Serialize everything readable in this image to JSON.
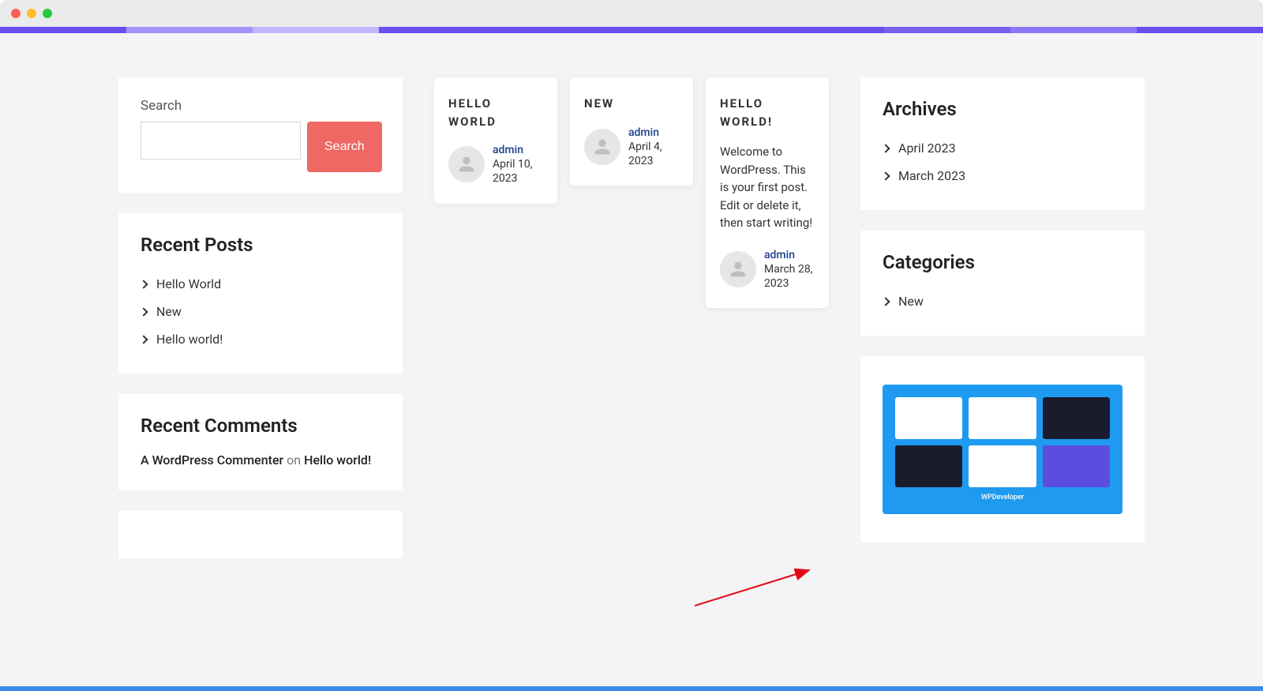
{
  "sidebar_left": {
    "search": {
      "label": "Search",
      "button": "Search",
      "value": ""
    },
    "recent_posts": {
      "heading": "Recent Posts",
      "items": [
        "Hello World",
        "New",
        "Hello world!"
      ]
    },
    "recent_comments": {
      "heading": "Recent Comments",
      "commenter": "A WordPress Commenter",
      "on": "on",
      "post": "Hello world!"
    }
  },
  "posts": [
    {
      "title": "HELLO WORLD",
      "author": "admin",
      "date": "April 10, 2023",
      "excerpt": ""
    },
    {
      "title": "NEW",
      "author": "admin",
      "date": "April 4, 2023",
      "excerpt": ""
    },
    {
      "title": "HELLO WORLD!",
      "author": "admin",
      "date": "March 28, 2023",
      "excerpt": "Welcome to WordPress. This is your first post. Edit or delete it, then start writing!"
    }
  ],
  "sidebar_right": {
    "archives": {
      "heading": "Archives",
      "items": [
        "April 2023",
        "March 2023"
      ]
    },
    "categories": {
      "heading": "Categories",
      "items": [
        "New"
      ]
    },
    "promo_footer": "WPDeveloper"
  }
}
